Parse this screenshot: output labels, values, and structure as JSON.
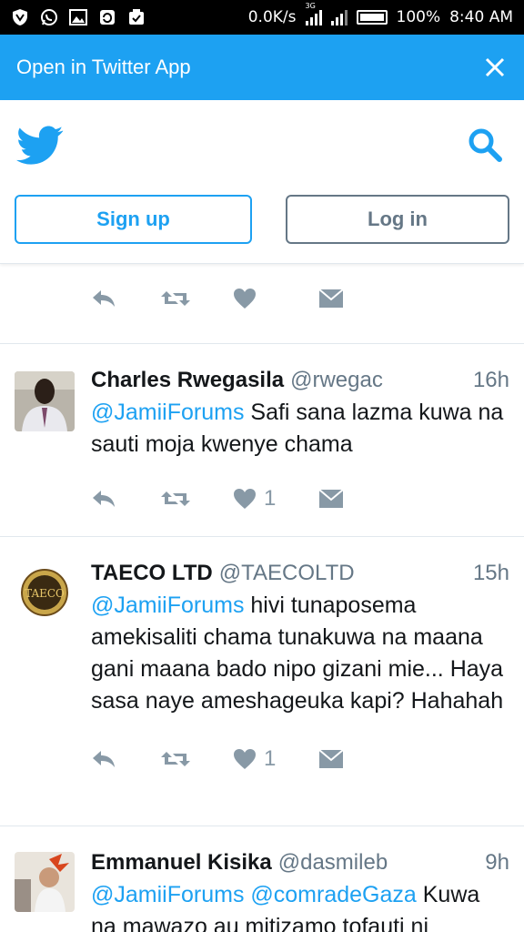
{
  "status_bar": {
    "speed": "0.0K/s",
    "network_tag": "3G",
    "battery": "100%",
    "time": "8:40 AM"
  },
  "banner": {
    "text": "Open in Twitter App"
  },
  "header": {
    "signup_label": "Sign up",
    "login_label": "Log in"
  },
  "colors": {
    "twitter_blue": "#1da1f2",
    "gray": "#657786",
    "action_gray": "#8899a6"
  },
  "tweets": [
    {
      "name": "Charles Rwegasila",
      "handle": "@rwegac",
      "time": "16h",
      "mentions": "@JamiiForums",
      "text": "Safi sana lazma kuwa na sauti moja kwenye chama",
      "likes": "1"
    },
    {
      "name": "TAECO LTD",
      "handle": "@TAECOLTD",
      "time": "15h",
      "mentions": "@JamiiForums",
      "text": "hivi tunaposema amekisaliti chama tunakuwa na maana gani maana bado nipo gizani mie... Haya sasa naye ameshageuka kapi? Hahahah",
      "likes": "1",
      "avatar_text": "TAECO"
    },
    {
      "name": "Emmanuel Kisika",
      "handle": "@dasmileb",
      "time": "9h",
      "mentions": "@JamiiForums @comradeGaza",
      "text": "Kuwa na mawazo au mitizamo tofauti ni"
    }
  ]
}
